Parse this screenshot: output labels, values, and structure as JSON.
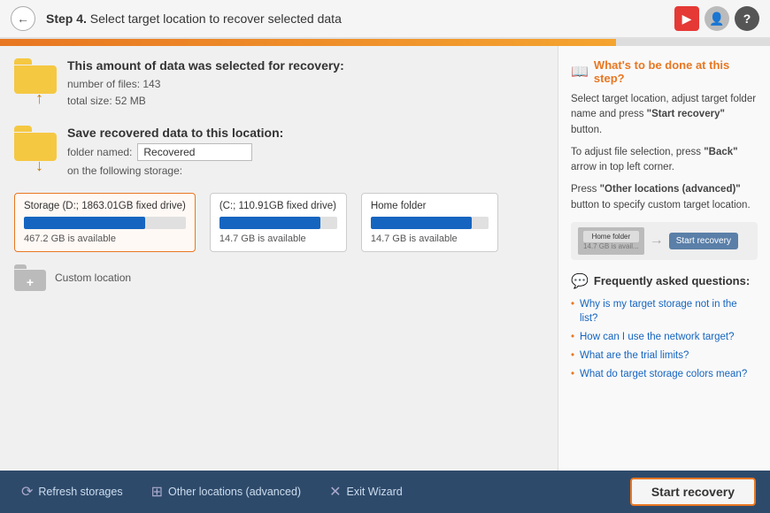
{
  "header": {
    "step_label": "Step 4.",
    "title": " Select target location to recover selected data"
  },
  "progress": {
    "fill_percent": 80
  },
  "section1": {
    "title": "This amount of data was selected for recovery:",
    "line1": "number of files: 143",
    "line2": "total size: 52 MB"
  },
  "section2": {
    "title": "Save recovered data to this location:",
    "folder_label": "folder named:",
    "folder_value": "Recovered",
    "storage_label": "on the following storage:"
  },
  "storages": [
    {
      "id": "storage_d",
      "title": "Storage (D:; 1863.01GB fixed drive)",
      "fill_percent": 75,
      "available": "467.2 GB is available",
      "selected": true
    },
    {
      "id": "storage_c",
      "title": "(C:; 110.91GB fixed drive)",
      "fill_percent": 86,
      "available": "14.7 GB is available",
      "selected": false
    },
    {
      "id": "home_folder",
      "title": "Home folder",
      "fill_percent": 86,
      "available": "14.7 GB is available",
      "selected": false
    }
  ],
  "custom_location_label": "Custom location",
  "right_panel": {
    "help_title": "What's to be done at this step?",
    "help_icon": "📖",
    "help_p1": "Select target location, adjust target folder name and press ",
    "help_p1_bold": "\"Start recovery\"",
    "help_p1_end": " button.",
    "help_p2_pre": "To adjust file selection, press ",
    "help_p2_bold": "\"Back\"",
    "help_p2_end": " arrow in top left corner.",
    "help_p3_pre": "Press ",
    "help_p3_bold": "\"Other locations (advanced)\"",
    "help_p3_end": " button to specify custom target location.",
    "mini_folder_label": "Home folder",
    "mini_folder_sub": "14.7 GB is avail...",
    "mini_start_label": "Start recovery",
    "faq_title": "Frequently asked questions:",
    "faq_icon": "💬",
    "faq_items": [
      "Why is my target storage not in the list?",
      "How can I use the network target?",
      "What are the trial limits?",
      "What do target storage colors mean?"
    ]
  },
  "footer": {
    "refresh_label": "Refresh storages",
    "other_label": "Other locations (advanced)",
    "exit_label": "Exit Wizard",
    "start_label": "Start recovery"
  }
}
